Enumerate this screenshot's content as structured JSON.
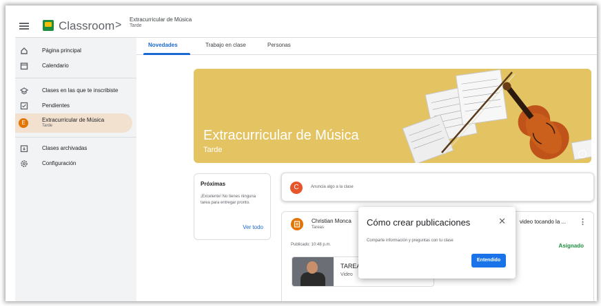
{
  "header": {
    "app_name": "Classroom",
    "breadcrumb_separator": ">",
    "class_title": "Extracurricular de Música",
    "class_section": "Tarde"
  },
  "sidebar": {
    "items": [
      {
        "label": "Página principal",
        "icon": "home-icon"
      },
      {
        "label": "Calendario",
        "icon": "calendar-icon"
      },
      {
        "label": "Clases en las que te inscribiste",
        "icon": "school-icon"
      },
      {
        "label": "Pendientes",
        "icon": "checklist-icon"
      },
      {
        "label": "Extracurricular de Música",
        "sub": "Tarde",
        "avatar": "E"
      },
      {
        "label": "Clases archivadas",
        "icon": "archive-icon"
      },
      {
        "label": "Configuración",
        "icon": "gear-icon"
      }
    ]
  },
  "tabs": [
    {
      "label": "Novedades"
    },
    {
      "label": "Trabajo en clase"
    },
    {
      "label": "Personas"
    }
  ],
  "banner": {
    "title": "Extracurricular de Música",
    "subtitle": "Tarde",
    "color": "#e4c462"
  },
  "upcoming": {
    "title": "Próximas",
    "text": "¡Excelente! No tienes ninguna tarea para entregar pronto.",
    "link": "Ver todo"
  },
  "announce": {
    "avatar": "C",
    "placeholder": "Anuncia algo a la clase"
  },
  "post": {
    "author": "Christian Monca",
    "type": "Tareas",
    "title_right": "video tocando la ...",
    "published": "Publicado: 10:48 p.m.",
    "status": "Asignado",
    "attachment_title": "TAREA",
    "attachment_sub": "Video"
  },
  "dialog": {
    "title": "Cómo crear publicaciones",
    "close": "✕",
    "text": "Comparte información y preguntas con tu clase",
    "button": "Entendido"
  },
  "colors": {
    "accent": "#1967d2",
    "button": "#1a73e8",
    "status_green": "#1e8e3e"
  }
}
